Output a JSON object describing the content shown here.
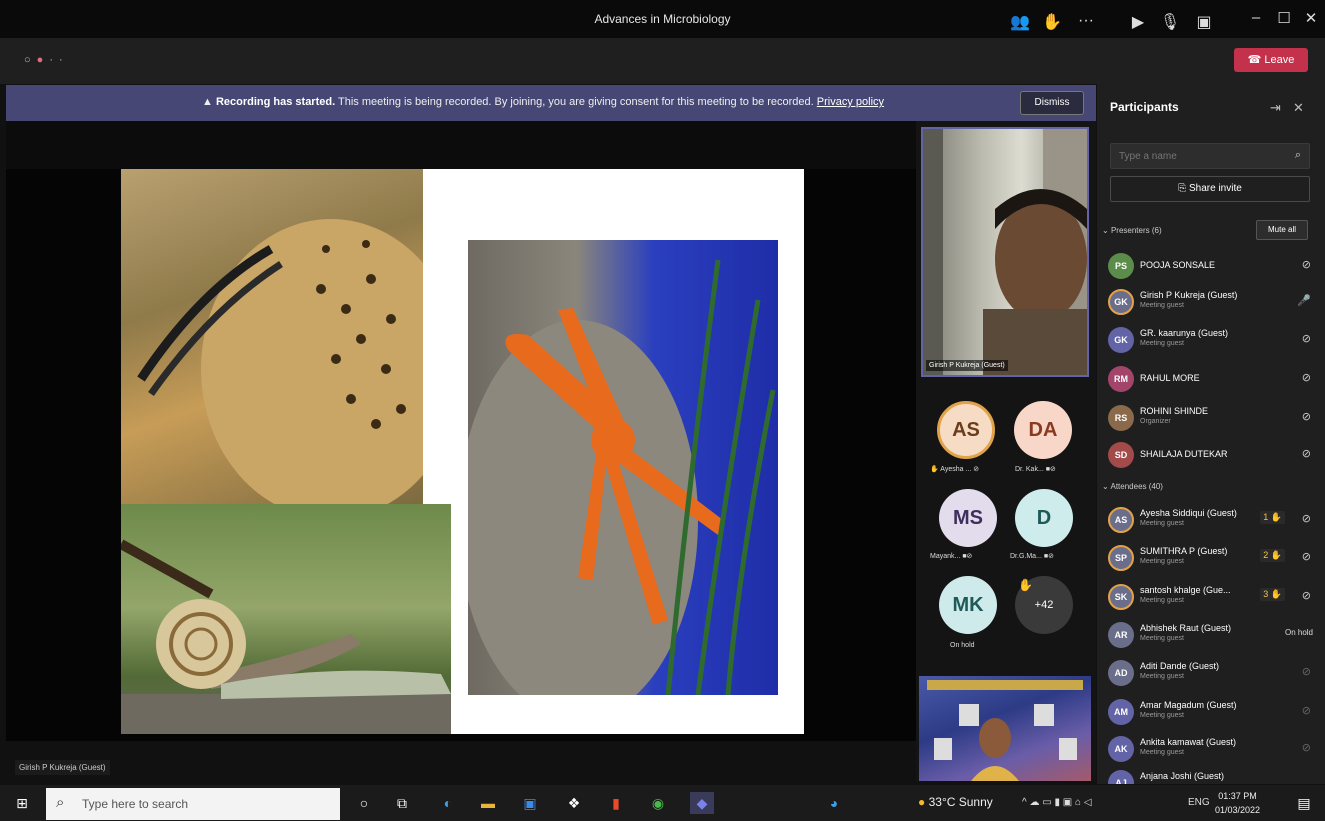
{
  "window": {
    "title": "Advances in Microbiology"
  },
  "toolbar": {
    "leave_label": "Leave"
  },
  "banner": {
    "bold": "Recording has started.",
    "text": " This meeting is being recorded. By joining, you are giving consent for this meeting to be recorded. ",
    "link": "Privacy policy",
    "dismiss": "Dismiss"
  },
  "stage": {
    "presenter_label": "Girish P Kukreja (Guest)"
  },
  "video": {
    "presenter_name": "Girish P Kukreja (Guest)",
    "tiles": [
      {
        "initials": "AS",
        "caption": "Ayesha ...",
        "bg": "#f6dcc4",
        "fg": "#6b3d1e"
      },
      {
        "initials": "DA",
        "caption": "Dr. Kak...",
        "bg": "#f8d7c8",
        "fg": "#8a3a20"
      },
      {
        "initials": "MS",
        "caption": "Mayank...",
        "bg": "#e3dcec",
        "fg": "#3f2f5c"
      },
      {
        "initials": "D",
        "caption": "Dr.G.Ma...",
        "bg": "#cfecec",
        "fg": "#1f5a5a"
      },
      {
        "initials": "MK",
        "caption": "On hold",
        "bg": "#cfeaea",
        "fg": "#1f5a5a"
      },
      {
        "initials": "+42",
        "caption": "",
        "bg": "#3a3a3a",
        "fg": "#ffffff"
      }
    ]
  },
  "participants": {
    "title": "Participants",
    "search_placeholder": "Type a name",
    "share_invite": "Share invite",
    "presenters_header": "Presenters (6)",
    "mute_all": "Mute all",
    "attendees_header": "Attendees (40)",
    "presenters": [
      {
        "initials": "PS",
        "name": "POOJA SONSALE",
        "sub": "",
        "color": "#5b8c4a"
      },
      {
        "initials": "GK",
        "name": "Girish P Kukreja (Guest)",
        "sub": "Meeting guest",
        "color": "#6b6e8a"
      },
      {
        "initials": "GK",
        "name": "GR. kaarunya (Guest)",
        "sub": "Meeting guest",
        "color": "#6264a7"
      },
      {
        "initials": "RM",
        "name": "RAHUL MORE",
        "sub": "",
        "color": "#a3456b"
      },
      {
        "initials": "RS",
        "name": "ROHINI SHINDE",
        "sub": "Organizer",
        "color": "#8a6a4a"
      },
      {
        "initials": "SD",
        "name": "SHAILAJA DUTEKAR",
        "sub": "",
        "color": "#a34a4a"
      }
    ],
    "attendees": [
      {
        "initials": "AS",
        "name": "Ayesha Siddiqui (Guest)",
        "sub": "Meeting guest",
        "color": "#6b6e8a",
        "hand": "1",
        "hold": ""
      },
      {
        "initials": "SP",
        "name": "SUMITHRA P (Guest)",
        "sub": "Meeting guest",
        "color": "#6b6e8a",
        "hand": "2",
        "hold": ""
      },
      {
        "initials": "SK",
        "name": "santosh khalge (Gue...",
        "sub": "Meeting guest",
        "color": "#6b6e8a",
        "hand": "3",
        "hold": ""
      },
      {
        "initials": "AR",
        "name": "Abhishek Raut (Guest)",
        "sub": "Meeting guest",
        "color": "#6b6e8a",
        "hand": "",
        "hold": "On hold"
      },
      {
        "initials": "AD",
        "name": "Aditi Dande (Guest)",
        "sub": "Meeting guest",
        "color": "#6b6e8a",
        "hand": "",
        "hold": ""
      },
      {
        "initials": "AM",
        "name": "Amar Magadum (Guest)",
        "sub": "Meeting guest",
        "color": "#6264a7",
        "hand": "",
        "hold": ""
      },
      {
        "initials": "AK",
        "name": "Ankita kamawat (Guest)",
        "sub": "Meeting guest",
        "color": "#6264a7",
        "hand": "",
        "hold": ""
      },
      {
        "initials": "AJ",
        "name": "Anjana Joshi (Guest)",
        "sub": "",
        "color": "#6264a7",
        "hand": "",
        "hold": ""
      }
    ]
  },
  "taskbar": {
    "search_placeholder": "Type here to search",
    "weather": "33°C  Sunny",
    "lang": "ENG",
    "time": "01:37 PM",
    "date": "01/03/2022"
  },
  "colors": {
    "accent": "#6264a7",
    "leave": "#c4314b",
    "banner": "#464775"
  }
}
